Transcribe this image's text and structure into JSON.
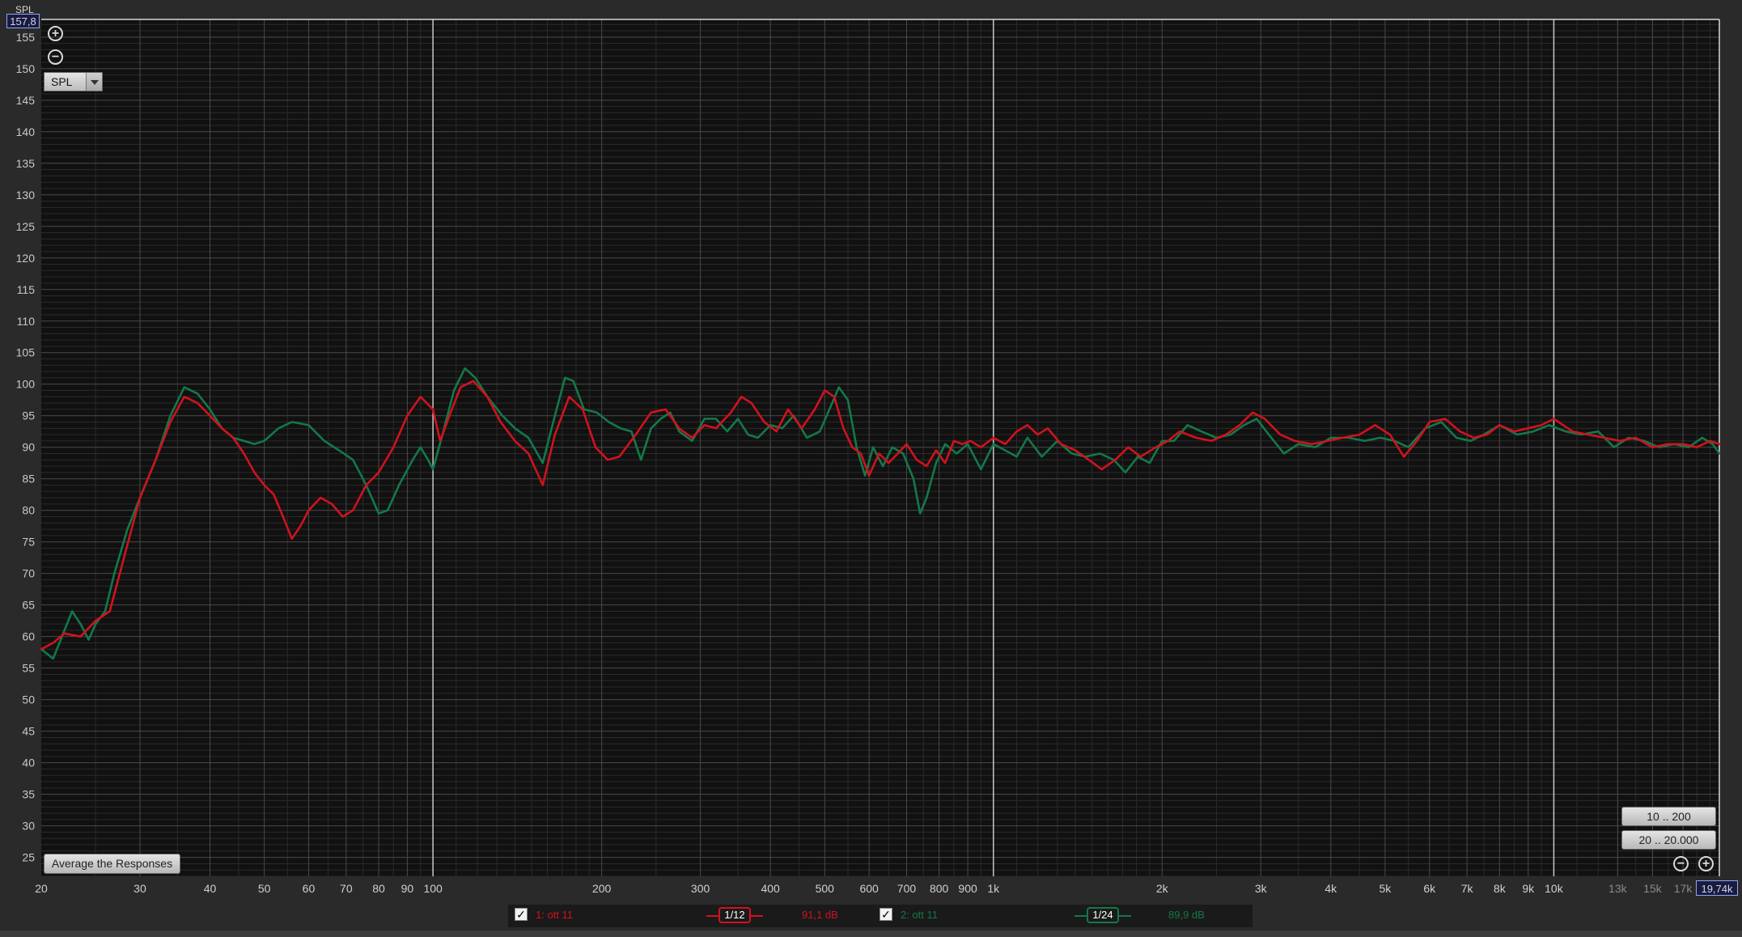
{
  "colors": {
    "background": "#111111",
    "grid_major": "#4a4a4a",
    "grid_minor": "#2b2b2b",
    "grid_decade": "#c8c8c8",
    "series1": "#d1121d",
    "series2": "#13784a"
  },
  "axis": {
    "y_label": "SPL",
    "y_top_value": "157,8",
    "x_right_value": "19,74k"
  },
  "controls": {
    "zoom_in_icon": "zoom-in-icon",
    "zoom_out_icon": "zoom-out-icon",
    "spl_select_value": "SPL",
    "average_button": "Average the Responses",
    "range_button_1": "10 .. 200",
    "range_button_2": "20 .. 20.000"
  },
  "legend": {
    "items": [
      {
        "checked": true,
        "name": "1: ott 11",
        "smoothing": "1/12",
        "level": "91,1 dB",
        "color": "#d1121d"
      },
      {
        "checked": true,
        "name": "2: ott 11",
        "smoothing": "1/24",
        "level": "89,9 dB",
        "color": "#13784a"
      }
    ]
  },
  "chart_data": {
    "type": "line",
    "title": "",
    "xlabel": "",
    "ylabel": "SPL",
    "x_scale": "log",
    "xlim": [
      20,
      19740
    ],
    "ylim": [
      22,
      157.8
    ],
    "grid": true,
    "y_ticks": [
      25,
      30,
      35,
      40,
      45,
      50,
      55,
      60,
      65,
      70,
      75,
      80,
      85,
      90,
      95,
      100,
      105,
      110,
      115,
      120,
      125,
      130,
      135,
      140,
      145,
      150,
      155
    ],
    "x_ticks": [
      {
        "value": 20,
        "label": "20"
      },
      {
        "value": 30,
        "label": "30"
      },
      {
        "value": 40,
        "label": "40"
      },
      {
        "value": 50,
        "label": "50"
      },
      {
        "value": 60,
        "label": "60"
      },
      {
        "value": 70,
        "label": "70"
      },
      {
        "value": 80,
        "label": "80"
      },
      {
        "value": 90,
        "label": "90"
      },
      {
        "value": 100,
        "label": "100"
      },
      {
        "value": 200,
        "label": "200"
      },
      {
        "value": 300,
        "label": "300"
      },
      {
        "value": 400,
        "label": "400"
      },
      {
        "value": 500,
        "label": "500"
      },
      {
        "value": 600,
        "label": "600"
      },
      {
        "value": 700,
        "label": "700"
      },
      {
        "value": 800,
        "label": "800"
      },
      {
        "value": 900,
        "label": "900"
      },
      {
        "value": 1000,
        "label": "1k"
      },
      {
        "value": 2000,
        "label": "2k"
      },
      {
        "value": 3000,
        "label": "3k"
      },
      {
        "value": 4000,
        "label": "4k"
      },
      {
        "value": 5000,
        "label": "5k"
      },
      {
        "value": 6000,
        "label": "6k"
      },
      {
        "value": 7000,
        "label": "7k"
      },
      {
        "value": 8000,
        "label": "8k"
      },
      {
        "value": 9000,
        "label": "9k"
      },
      {
        "value": 10000,
        "label": "10k"
      },
      {
        "value": 13000,
        "label": "13k"
      },
      {
        "value": 15000,
        "label": "15k"
      },
      {
        "value": 17000,
        "label": "17k"
      }
    ],
    "series": [
      {
        "name": "1: ott 11",
        "color": "#d1121d",
        "points": [
          [
            20,
            58
          ],
          [
            21,
            59
          ],
          [
            22,
            60.5
          ],
          [
            23.5,
            60
          ],
          [
            25,
            62.5
          ],
          [
            26.5,
            64
          ],
          [
            28,
            72
          ],
          [
            30,
            82
          ],
          [
            32,
            88
          ],
          [
            34,
            94
          ],
          [
            36,
            98
          ],
          [
            38,
            97
          ],
          [
            40,
            95
          ],
          [
            42,
            93
          ],
          [
            44,
            91.5
          ],
          [
            46,
            89
          ],
          [
            48,
            86
          ],
          [
            50,
            84
          ],
          [
            52,
            82.5
          ],
          [
            54,
            79
          ],
          [
            56,
            75.5
          ],
          [
            58,
            77.5
          ],
          [
            60,
            80
          ],
          [
            63,
            82
          ],
          [
            66,
            81
          ],
          [
            69,
            79
          ],
          [
            72,
            80
          ],
          [
            76,
            84
          ],
          [
            80,
            86
          ],
          [
            85,
            90
          ],
          [
            90,
            95
          ],
          [
            95,
            98
          ],
          [
            100,
            96
          ],
          [
            103,
            91
          ],
          [
            107,
            95
          ],
          [
            112,
            99.5
          ],
          [
            118,
            100.5
          ],
          [
            125,
            98
          ],
          [
            132,
            94
          ],
          [
            140,
            91
          ],
          [
            148,
            89
          ],
          [
            157,
            84
          ],
          [
            165,
            92
          ],
          [
            175,
            98
          ],
          [
            185,
            96
          ],
          [
            195,
            90
          ],
          [
            205,
            88
          ],
          [
            215,
            88.5
          ],
          [
            230,
            92
          ],
          [
            245,
            95.5
          ],
          [
            260,
            96
          ],
          [
            275,
            93
          ],
          [
            290,
            91.5
          ],
          [
            305,
            93.5
          ],
          [
            320,
            93
          ],
          [
            340,
            95.5
          ],
          [
            355,
            98
          ],
          [
            370,
            97
          ],
          [
            390,
            94
          ],
          [
            410,
            92.5
          ],
          [
            430,
            96
          ],
          [
            455,
            93
          ],
          [
            480,
            96
          ],
          [
            500,
            99
          ],
          [
            520,
            98
          ],
          [
            540,
            93
          ],
          [
            560,
            90
          ],
          [
            580,
            89
          ],
          [
            600,
            85.5
          ],
          [
            625,
            89
          ],
          [
            650,
            87.5
          ],
          [
            675,
            89
          ],
          [
            700,
            90.5
          ],
          [
            730,
            88
          ],
          [
            760,
            87
          ],
          [
            790,
            89.5
          ],
          [
            820,
            87.5
          ],
          [
            850,
            91
          ],
          [
            880,
            90.5
          ],
          [
            910,
            91
          ],
          [
            950,
            90
          ],
          [
            1000,
            91.5
          ],
          [
            1050,
            90.5
          ],
          [
            1100,
            92.5
          ],
          [
            1150,
            93.5
          ],
          [
            1200,
            92
          ],
          [
            1250,
            93
          ],
          [
            1320,
            90.5
          ],
          [
            1400,
            89.5
          ],
          [
            1480,
            88
          ],
          [
            1560,
            86.5
          ],
          [
            1650,
            88
          ],
          [
            1740,
            90
          ],
          [
            1830,
            88.5
          ],
          [
            1950,
            90
          ],
          [
            2050,
            91
          ],
          [
            2150,
            92.5
          ],
          [
            2300,
            91.5
          ],
          [
            2450,
            91
          ],
          [
            2600,
            92
          ],
          [
            2750,
            93.5
          ],
          [
            2900,
            95.5
          ],
          [
            3050,
            94.5
          ],
          [
            3250,
            92
          ],
          [
            3450,
            91
          ],
          [
            3700,
            90.5
          ],
          [
            3950,
            91
          ],
          [
            4200,
            91.5
          ],
          [
            4500,
            92
          ],
          [
            4800,
            93.5
          ],
          [
            5100,
            92
          ],
          [
            5400,
            88.5
          ],
          [
            5700,
            91
          ],
          [
            6000,
            94
          ],
          [
            6400,
            94.5
          ],
          [
            6800,
            92.5
          ],
          [
            7200,
            91.5
          ],
          [
            7600,
            92
          ],
          [
            8000,
            93.5
          ],
          [
            8500,
            92.5
          ],
          [
            9000,
            93
          ],
          [
            9500,
            93.5
          ],
          [
            10000,
            94.5
          ],
          [
            10800,
            92.5
          ],
          [
            11500,
            92
          ],
          [
            12300,
            91.5
          ],
          [
            13100,
            91
          ],
          [
            14000,
            91.5
          ],
          [
            15000,
            90
          ],
          [
            16000,
            90.5
          ],
          [
            17000,
            90.5
          ],
          [
            18000,
            90
          ],
          [
            19000,
            91
          ],
          [
            19740,
            90.5
          ]
        ]
      },
      {
        "name": "2: ott 11",
        "color": "#13784a",
        "points": [
          [
            20,
            58
          ],
          [
            21,
            56.5
          ],
          [
            22,
            61
          ],
          [
            22.7,
            64
          ],
          [
            23.5,
            62
          ],
          [
            24.3,
            59.5
          ],
          [
            25,
            62
          ],
          [
            26,
            64
          ],
          [
            27,
            70
          ],
          [
            28.5,
            77
          ],
          [
            30,
            82
          ],
          [
            32,
            88
          ],
          [
            34,
            95
          ],
          [
            36,
            99.5
          ],
          [
            38,
            98.5
          ],
          [
            40,
            96
          ],
          [
            42,
            93
          ],
          [
            44,
            91.5
          ],
          [
            46,
            91
          ],
          [
            48,
            90.5
          ],
          [
            50,
            91
          ],
          [
            53,
            93
          ],
          [
            56,
            94
          ],
          [
            60,
            93.5
          ],
          [
            64,
            91
          ],
          [
            68,
            89.5
          ],
          [
            72,
            88
          ],
          [
            76,
            84
          ],
          [
            80,
            79.5
          ],
          [
            83,
            80
          ],
          [
            87,
            84
          ],
          [
            92,
            88
          ],
          [
            95,
            90
          ],
          [
            98,
            88
          ],
          [
            100,
            86.5
          ],
          [
            104,
            92
          ],
          [
            109,
            99
          ],
          [
            114,
            102.5
          ],
          [
            119,
            101
          ],
          [
            125,
            98
          ],
          [
            133,
            95
          ],
          [
            140,
            93
          ],
          [
            148,
            91.5
          ],
          [
            157,
            87.5
          ],
          [
            165,
            95
          ],
          [
            172,
            101
          ],
          [
            178,
            100.5
          ],
          [
            186,
            96
          ],
          [
            196,
            95.5
          ],
          [
            206,
            94
          ],
          [
            216,
            93
          ],
          [
            226,
            92.5
          ],
          [
            235,
            88
          ],
          [
            245,
            93
          ],
          [
            255,
            94.5
          ],
          [
            265,
            95.5
          ],
          [
            275,
            92.5
          ],
          [
            290,
            91
          ],
          [
            305,
            94.5
          ],
          [
            320,
            94.5
          ],
          [
            335,
            92.5
          ],
          [
            350,
            94.5
          ],
          [
            365,
            92
          ],
          [
            380,
            91.5
          ],
          [
            400,
            93.5
          ],
          [
            420,
            93
          ],
          [
            440,
            95
          ],
          [
            465,
            91.5
          ],
          [
            490,
            92.5
          ],
          [
            510,
            96
          ],
          [
            530,
            99.5
          ],
          [
            550,
            97.5
          ],
          [
            570,
            90
          ],
          [
            590,
            85.5
          ],
          [
            610,
            90
          ],
          [
            635,
            87
          ],
          [
            660,
            90
          ],
          [
            690,
            89
          ],
          [
            720,
            85
          ],
          [
            740,
            79.5
          ],
          [
            760,
            82
          ],
          [
            790,
            87.5
          ],
          [
            820,
            90.5
          ],
          [
            860,
            89
          ],
          [
            900,
            90.5
          ],
          [
            950,
            86.5
          ],
          [
            1000,
            90.5
          ],
          [
            1050,
            89.5
          ],
          [
            1100,
            88.5
          ],
          [
            1150,
            91.5
          ],
          [
            1220,
            88.5
          ],
          [
            1300,
            91
          ],
          [
            1380,
            89
          ],
          [
            1460,
            88.5
          ],
          [
            1550,
            89
          ],
          [
            1640,
            88
          ],
          [
            1720,
            86
          ],
          [
            1810,
            88.5
          ],
          [
            1900,
            87.5
          ],
          [
            2000,
            91
          ],
          [
            2100,
            91
          ],
          [
            2220,
            93.5
          ],
          [
            2350,
            92.5
          ],
          [
            2500,
            91.5
          ],
          [
            2650,
            92
          ],
          [
            2800,
            93.5
          ],
          [
            2950,
            94.5
          ],
          [
            3100,
            92
          ],
          [
            3300,
            89
          ],
          [
            3500,
            90.5
          ],
          [
            3750,
            90
          ],
          [
            4000,
            91.5
          ],
          [
            4300,
            91.5
          ],
          [
            4600,
            91
          ],
          [
            4900,
            91.5
          ],
          [
            5200,
            91
          ],
          [
            5500,
            90
          ],
          [
            5900,
            93
          ],
          [
            6300,
            94
          ],
          [
            6700,
            91.5
          ],
          [
            7100,
            91
          ],
          [
            7500,
            92
          ],
          [
            8000,
            93.5
          ],
          [
            8600,
            92
          ],
          [
            9200,
            92.5
          ],
          [
            9800,
            93.5
          ],
          [
            10500,
            92.5
          ],
          [
            11200,
            92
          ],
          [
            12000,
            92.5
          ],
          [
            12800,
            90
          ],
          [
            13600,
            91.5
          ],
          [
            14500,
            91
          ],
          [
            15400,
            90
          ],
          [
            16400,
            90.5
          ],
          [
            17400,
            90
          ],
          [
            18400,
            91.5
          ],
          [
            19200,
            90.5
          ],
          [
            19740,
            89
          ]
        ]
      }
    ]
  }
}
